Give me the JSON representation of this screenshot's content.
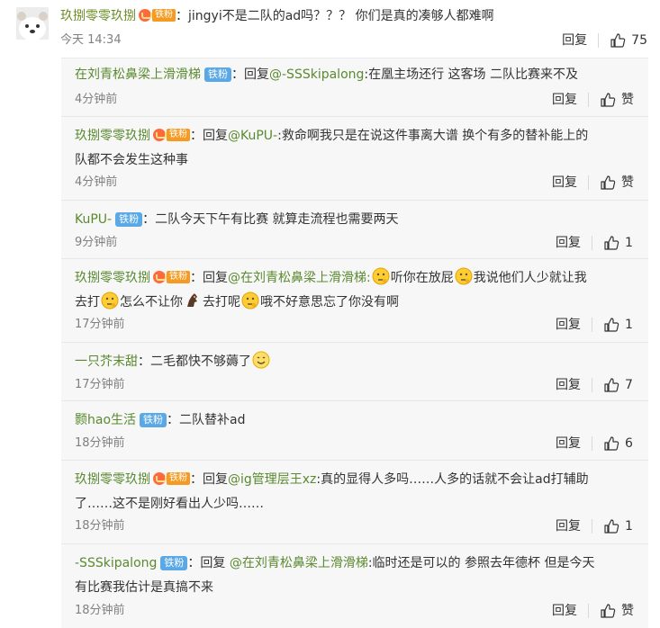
{
  "main": {
    "user": "玖捌零零玖捌",
    "badge": "铁粉",
    "colon": "：",
    "text": "jingyi不是二队的ad吗？？？ 你们是真的凑够人都难啊",
    "time": "今天 14:34",
    "reply_label": "回复",
    "like_count": "75"
  },
  "replies": [
    {
      "user": "在刘青松鼻梁上滑滑梯",
      "badge": "铁粉",
      "badge_color": "#5aa9e6",
      "line1_pre": "回复",
      "mention": "@-SSSkipalong",
      "line1_post": ":在凰主场还行 这客场 二队比赛来不及",
      "time": "4分钟前",
      "reply_label": "回复",
      "like": "赞"
    },
    {
      "user": "玖捌零零玖捌",
      "badge": "铁粉",
      "line1_pre": "回复",
      "mention": "@KuPU-",
      "line1_post": ":救命啊我只是在说这件事离大谱 换个有多的替补能上的",
      "line2": "队都不会发生这种事",
      "time": "4分钟前",
      "reply_label": "回复",
      "like": "赞"
    },
    {
      "user": "KuPU-",
      "badge": "铁粉",
      "text": "二队今天下午有比赛 就算走流程也需要两天",
      "time": "9分钟前",
      "reply_label": "回复",
      "like": "1"
    },
    {
      "user": "玖捌零零玖捌",
      "badge": "铁粉",
      "line1_pre": "回复",
      "mention": "@在刘青松鼻梁上滑滑梯",
      "seg1": ":",
      "seg2": "听你在放屁",
      "seg3": "我说他们人少就让我",
      "l2_seg1": "去打",
      "l2_seg2": "怎么不让你",
      "l2_seg3": "去打呢",
      "l2_seg4": "哦不好意思忘了你没有啊",
      "time": "17分钟前",
      "reply_label": "回复",
      "like": "1"
    },
    {
      "user": "一只芥末甜",
      "text": "二毛都快不够薅了",
      "time": "17分钟前",
      "reply_label": "回复",
      "like": "7"
    },
    {
      "user": "颢hao生活",
      "badge": "铁粉",
      "text": "二队替补ad",
      "time": "18分钟前",
      "reply_label": "回复",
      "like": "6"
    },
    {
      "user": "玖捌零零玖捌",
      "badge": "铁粉",
      "line1_pre": "回复",
      "mention": "@ig管理层王xz",
      "line1_post": ":真的显得人多吗……人多的话就不会让ad打辅助",
      "line2": "了……这不是刚好看出人少吗……",
      "time": "18分钟前",
      "reply_label": "回复",
      "like": "1"
    },
    {
      "user": "-SSSkipalong",
      "badge": "铁粉",
      "line1_pre": "回复 ",
      "mention": "@在刘青松鼻梁上滑滑梯",
      "line1_post": ":临时还是可以的 参照去年德杯 但是今天",
      "line2": "有比赛我估计是真搞不来",
      "time": "18分钟前",
      "reply_label": "回复",
      "like": "赞"
    }
  ]
}
